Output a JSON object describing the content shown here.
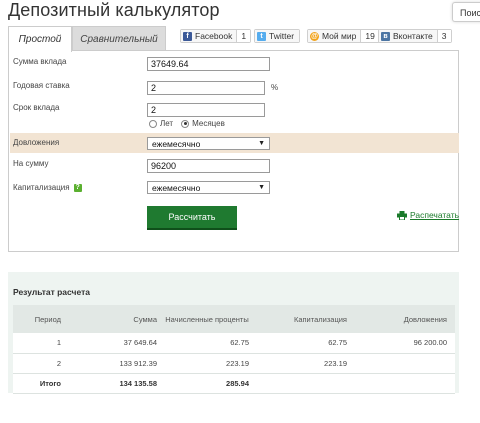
{
  "page": {
    "title": "Депозитный калькулятор",
    "search_tab": "Поис"
  },
  "tabs": [
    {
      "label": "Простой",
      "active": true
    },
    {
      "label": "Сравнительный",
      "active": false
    }
  ],
  "social": [
    {
      "name": "Facebook",
      "count": "1",
      "color": "#3b5998",
      "icon": "facebook-icon"
    },
    {
      "name": "Twitter",
      "count": "",
      "color": "#55acee",
      "icon": "twitter-icon"
    },
    {
      "name": "Мой мир",
      "count": "19",
      "color": "#f2a31b",
      "icon": "moimir-icon"
    },
    {
      "name": "Вконтакте",
      "count": "3",
      "color": "#4c75a3",
      "icon": "vkontakte-icon"
    }
  ],
  "form": {
    "amount": {
      "label": "Сумма вклада",
      "value": "37649.64"
    },
    "rate": {
      "label": "Годовая ставка",
      "value": "2",
      "unit": "%"
    },
    "term": {
      "label": "Срок вклада",
      "value": "2",
      "option_years": "Лет",
      "option_months": "Месяцев",
      "selected": "Месяцев"
    },
    "topup": {
      "label": "Довложения",
      "value": "ежемесячно"
    },
    "topup_amount": {
      "label": "На сумму",
      "value": "96200"
    },
    "capitalization": {
      "label": "Капитализация",
      "value": "ежемесячно",
      "help": "?"
    },
    "calculate_label": "Рассчитать",
    "print_label": "Распечатать"
  },
  "result": {
    "title": "Результат расчета",
    "columns": [
      "Период",
      "Сумма",
      "Начисленные проценты",
      "Капитализация",
      "Довложения"
    ],
    "rows": [
      [
        "1",
        "37 649.64",
        "62.75",
        "62.75",
        "96 200.00"
      ],
      [
        "2",
        "133 912.39",
        "223.19",
        "223.19",
        ""
      ]
    ],
    "total": [
      "Итого",
      "134 135.58",
      "285.94",
      "",
      ""
    ]
  },
  "colors": {
    "button": "#1f7a30",
    "band": "#f2e4d3",
    "result_bg": "#eef4f1",
    "link": "#1a7a2a"
  }
}
